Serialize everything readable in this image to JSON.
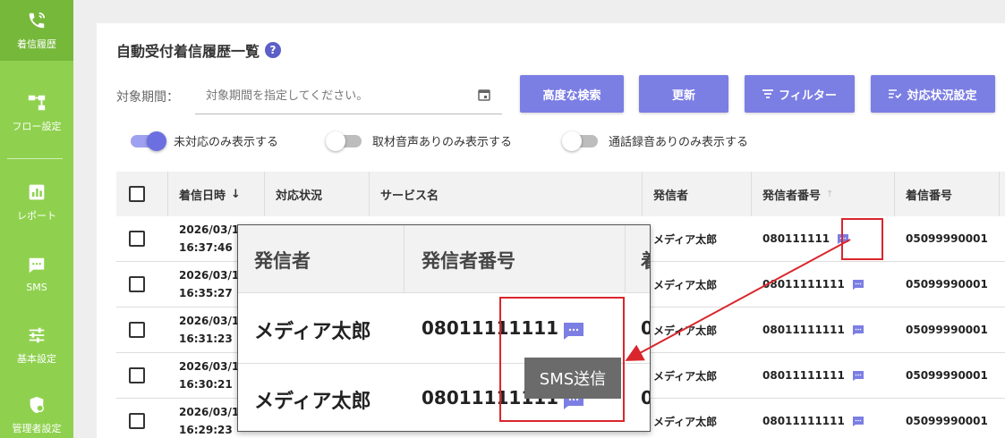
{
  "sidebar": {
    "items": [
      {
        "label": "着信履歴",
        "icon": "phone-history-icon"
      },
      {
        "label": "フロー設定",
        "icon": "flow-icon"
      },
      {
        "label": "レポート",
        "icon": "chart-icon"
      },
      {
        "label": "SMS",
        "icon": "sms-icon"
      },
      {
        "label": "基本設定",
        "icon": "sliders-icon"
      },
      {
        "label": "管理者設定",
        "icon": "admin-shield-icon"
      }
    ]
  },
  "header": {
    "title": "自動受付着信履歴一覧",
    "help": "?"
  },
  "filter": {
    "period_label": "対象期間：",
    "period_placeholder": "対象期間を指定してください。"
  },
  "buttons": {
    "advanced_search": "高度な検索",
    "refresh": "更新",
    "filter": "フィルター",
    "status_settings": "対応状況設定"
  },
  "toggles": [
    {
      "label": "未対応のみ表示する",
      "on": true
    },
    {
      "label": "取材音声ありのみ表示する",
      "on": false
    },
    {
      "label": "通話録音ありのみ表示する",
      "on": false
    }
  ],
  "table": {
    "headers": {
      "datetime": "着信日時",
      "status": "対応状況",
      "service": "サービス名",
      "caller": "発信者",
      "caller_number": "発信者番号",
      "incoming_number": "着信番号"
    },
    "sort_desc": "↓",
    "sort_faint": "↑",
    "rows": [
      {
        "date": "2026/03/1",
        "time": "16:37:46",
        "caller": "メディア太郎",
        "caller_number": "080111111",
        "incoming_number": "05099990001"
      },
      {
        "date": "2026/03/1",
        "time": "16:35:27",
        "caller": "メディア太郎",
        "caller_number": "08011111111",
        "incoming_number": "05099990001"
      },
      {
        "date": "2026/03/1",
        "time": "16:31:23",
        "caller": "メディア太郎",
        "caller_number": "08011111111",
        "incoming_number": "05099990001"
      },
      {
        "date": "2026/03/1",
        "time": "16:30:21",
        "caller": "メディア太郎",
        "caller_number": "08011111111",
        "incoming_number": "05099990001"
      },
      {
        "date": "2026/03/1",
        "time": "16:29:23",
        "caller": "メディア太郎",
        "caller_number": "08011111111",
        "incoming_number": "05099990001"
      }
    ]
  },
  "zoom": {
    "header_caller": "発信者",
    "header_caller_number": "発信者番号",
    "header_cut": "着",
    "rows": [
      {
        "caller": "メディア太郎",
        "caller_number": "08011111111",
        "cut": "0"
      },
      {
        "caller": "メディア太郎",
        "caller_number": "08011111111",
        "cut": "0"
      }
    ],
    "tooltip": "SMS送信"
  },
  "colors": {
    "sidebar": "#8fd14f",
    "sidebar_active": "#76b83a",
    "accent": "#7b7ee3",
    "sms_icon": "#7b7ee3",
    "highlight": "#d9262c"
  }
}
